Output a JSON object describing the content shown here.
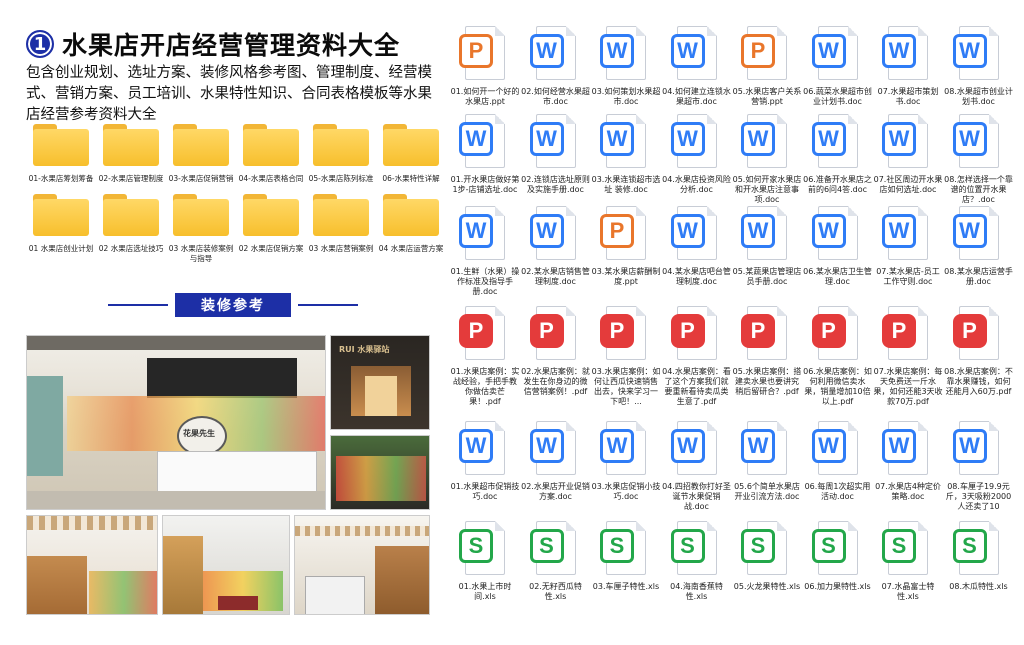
{
  "title": {
    "number": "1",
    "text": "水果店开店经营管理资料大全"
  },
  "description": "包含创业规划、选址方案、装修风格参考图、管理制度、经营模式、营销方案、员工培训、水果特性知识、合同表格模板等水果店经营参考资料大全",
  "folders": [
    "01-水果店筹划筹备",
    "02-水果店管理制度",
    "03-水果店促销营销",
    "04-水果店表格合同",
    "05-水果店陈列标准",
    "06-水果特性详解",
    "01 水果店创业计划",
    "02 水果店选址技巧",
    "03 水果店装修案例与指导",
    "02 水果店促销方案",
    "03 水果店营销案例",
    "04 水果店运营方案"
  ],
  "section": {
    "label": "装修参考"
  },
  "photo_captions": {
    "sign1": "花果先生",
    "sign2": "RUI 水果驿站",
    "sign3": "花果先生"
  },
  "files": [
    [
      {
        "type": "p",
        "icon": "ppt-icon",
        "name": "01.如何开一个好的水果店.ppt"
      },
      {
        "type": "w",
        "icon": "word-icon",
        "name": "02.如何经营水果超市.doc"
      },
      {
        "type": "w",
        "icon": "word-icon",
        "name": "03.如何策划水果超市.doc"
      },
      {
        "type": "w",
        "icon": "word-icon",
        "name": "04.如何建立连锁水果超市.doc"
      },
      {
        "type": "p",
        "icon": "ppt-icon",
        "name": "05.水果店客户关系营销.ppt"
      },
      {
        "type": "w",
        "icon": "word-icon",
        "name": "06.蔬菜水果超市创业计划书.doc"
      },
      {
        "type": "w",
        "icon": "word-icon",
        "name": "07.水果超市策划书.doc"
      },
      {
        "type": "w",
        "icon": "word-icon",
        "name": "08.水果超市创业计划书.doc"
      }
    ],
    [
      {
        "type": "w",
        "icon": "word-icon",
        "name": "01.开水果店做好第1步-店铺选址.doc"
      },
      {
        "type": "w",
        "icon": "word-icon",
        "name": "02.连锁店选址原则及实施手册.doc"
      },
      {
        "type": "w",
        "icon": "word-icon",
        "name": "03.水果连锁超市选址 装修.doc"
      },
      {
        "type": "w",
        "icon": "word-icon",
        "name": "04.水果店投资风险分析.doc"
      },
      {
        "type": "w",
        "icon": "word-icon",
        "name": "05.如何开家水果店和开水果店注意事项.doc"
      },
      {
        "type": "w",
        "icon": "word-icon",
        "name": "06.准备开水果店之前的6问4答.doc"
      },
      {
        "type": "w",
        "icon": "word-icon",
        "name": "07.社区周边开水果店如何选址.doc"
      },
      {
        "type": "w",
        "icon": "word-icon",
        "name": "08.怎样选择一个靠谱的位置开水果店？.doc"
      }
    ],
    [
      {
        "type": "w",
        "icon": "word-icon",
        "name": "01.生鲜（水果）操作标准及指导手册.doc"
      },
      {
        "type": "w",
        "icon": "word-icon",
        "name": "02.某水果店销售管理制度.doc"
      },
      {
        "type": "p",
        "icon": "ppt-icon",
        "name": "03.某水果店薪酬制度.ppt"
      },
      {
        "type": "w",
        "icon": "word-icon",
        "name": "04.某水果店吧台管理制度.doc"
      },
      {
        "type": "w",
        "icon": "word-icon",
        "name": "05.某蔬果店管理店员手册.doc"
      },
      {
        "type": "w",
        "icon": "word-icon",
        "name": "06.某水果店卫生管理.doc"
      },
      {
        "type": "w",
        "icon": "word-icon",
        "name": "07.某水果店-员工工作守则.doc"
      },
      {
        "type": "w",
        "icon": "word-icon",
        "name": "08.某水果店运营手册.doc"
      }
    ],
    [
      {
        "type": "pdf",
        "icon": "pdf-icon",
        "name": "01.水果店案例：实战经验，手把手教你做估卖芒果！.pdf"
      },
      {
        "type": "pdf",
        "icon": "pdf-icon",
        "name": "02.水果店案例：就发生在你身边的微信营销案例！.pdf"
      },
      {
        "type": "pdf",
        "icon": "pdf-icon",
        "name": "03.水果店案例：如何让西瓜快速销售出去，快来学习一下吧！..."
      },
      {
        "type": "pdf",
        "icon": "pdf-icon",
        "name": "04.水果店案例：看了这个方案我们就要重新看待卖瓜类生意了.pdf"
      },
      {
        "type": "pdf",
        "icon": "pdf-icon",
        "name": "05.水果店案例：搭建卖水果也要讲究稍后留研合？.pdf"
      },
      {
        "type": "pdf",
        "icon": "pdf-icon",
        "name": "06.水果店案例：如何利用微信卖水果，销量增加10倍以上.pdf"
      },
      {
        "type": "pdf",
        "icon": "pdf-icon",
        "name": "07.水果店案例：每天免费送一斤水果，如何还能3天收款70万.pdf"
      },
      {
        "type": "pdf",
        "icon": "pdf-icon",
        "name": "08.水果店案例：不靠水果赚钱，如何还能月入60万.pdf"
      }
    ],
    [
      {
        "type": "w",
        "icon": "word-icon",
        "name": "01.水果超市促销技巧.doc"
      },
      {
        "type": "w",
        "icon": "word-icon",
        "name": "02.水果店开业促销方案.doc"
      },
      {
        "type": "w",
        "icon": "word-icon",
        "name": "03.水果店促销小技巧.doc"
      },
      {
        "type": "w",
        "icon": "word-icon",
        "name": "04.四招教你打好圣诞节水果促销战.doc"
      },
      {
        "type": "w",
        "icon": "word-icon",
        "name": "05.6个简单水果店开业引流方法.doc"
      },
      {
        "type": "w",
        "icon": "word-icon",
        "name": "06.每周1次超实用活动.doc"
      },
      {
        "type": "w",
        "icon": "word-icon",
        "name": "07.水果店4种定价策略.doc"
      },
      {
        "type": "w",
        "icon": "word-icon",
        "name": "08.车厘子19.9元斤，3天吸粉2000人还卖了10"
      }
    ],
    [
      {
        "type": "s",
        "icon": "excel-icon",
        "name": "01.水果上市时间.xls"
      },
      {
        "type": "s",
        "icon": "excel-icon",
        "name": "02.无籽西瓜特性.xls"
      },
      {
        "type": "s",
        "icon": "excel-icon",
        "name": "03.车厘子特性.xls"
      },
      {
        "type": "s",
        "icon": "excel-icon",
        "name": "04.海南香蕉特性.xls"
      },
      {
        "type": "s",
        "icon": "excel-icon",
        "name": "05.火龙果特性.xls"
      },
      {
        "type": "s",
        "icon": "excel-icon",
        "name": "06.加力果特性.xls"
      },
      {
        "type": "s",
        "icon": "excel-icon",
        "name": "07.水晶富士特性.xls"
      },
      {
        "type": "s",
        "icon": "excel-icon",
        "name": "08.木瓜特性.xls"
      }
    ]
  ],
  "badge_letters": {
    "w": "W",
    "p": "P",
    "pdf": "P",
    "s": "S"
  },
  "colors": {
    "accent": "#1d2fa6",
    "word": "#2f7cf6",
    "ppt": "#e9762b",
    "pdf": "#e43b3b",
    "excel": "#23a74a",
    "folder": "#f7bf2c"
  }
}
